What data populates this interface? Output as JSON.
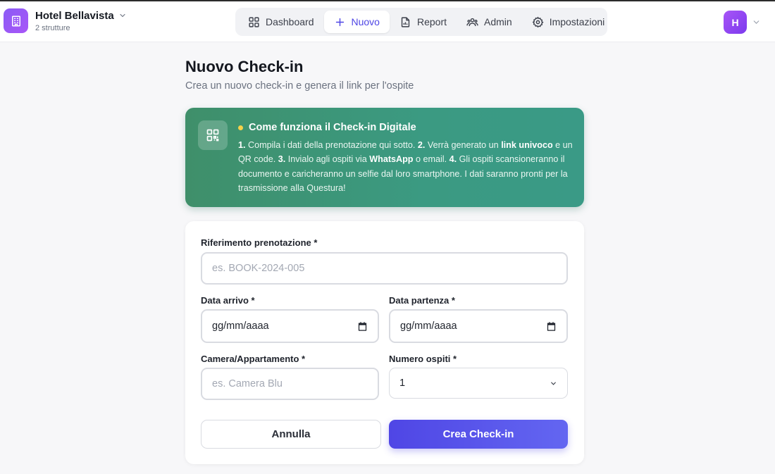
{
  "header": {
    "hotel_name": "Hotel Bellavista",
    "hotel_sub": "2 strutture",
    "avatar_initial": "H",
    "nav": [
      {
        "label": "Dashboard",
        "icon": "dashboard-icon"
      },
      {
        "label": "Nuovo",
        "icon": "plus-icon",
        "active": true
      },
      {
        "label": "Report",
        "icon": "report-icon"
      },
      {
        "label": "Admin",
        "icon": "users-icon"
      },
      {
        "label": "Impostazioni",
        "icon": "gear-icon"
      }
    ]
  },
  "page": {
    "title": "Nuovo Check-in",
    "subtitle": "Crea un nuovo check-in e genera il link per l'ospite"
  },
  "info": {
    "title": "Come funziona il Check-in Digitale",
    "parts": [
      {
        "t": "1.",
        "b": true
      },
      {
        "t": " Compila i dati della prenotazione qui sotto. ",
        "b": false
      },
      {
        "t": "2.",
        "b": true
      },
      {
        "t": " Verrà generato un ",
        "b": false
      },
      {
        "t": "link univoco",
        "b": true
      },
      {
        "t": " e un QR code. ",
        "b": false
      },
      {
        "t": "3.",
        "b": true
      },
      {
        "t": " Invialo agli ospiti via ",
        "b": false
      },
      {
        "t": "WhatsApp",
        "b": true
      },
      {
        "t": " o email. ",
        "b": false
      },
      {
        "t": "4.",
        "b": true
      },
      {
        "t": " Gli ospiti scansioneranno il documento e caricheranno un selfie dal loro smartphone. I dati saranno pronti per la trasmissione alla Questura!",
        "b": false
      }
    ]
  },
  "form": {
    "booking_label": "Riferimento prenotazione *",
    "booking_placeholder": "es. BOOK-2024-005",
    "arrival_label": "Data arrivo *",
    "arrival_value": "gg/mm/aaaa",
    "departure_label": "Data partenza *",
    "departure_value": "gg/mm/aaaa",
    "room_label": "Camera/Appartamento *",
    "room_placeholder": "es. Camera Blu",
    "guests_label": "Numero ospiti *",
    "guests_value": "1",
    "cancel_label": "Annulla",
    "submit_label": "Crea Check-in"
  },
  "colors": {
    "accent": "#4f46e5",
    "brand": "#8b5cf6",
    "info_bg": "#3b9a82"
  }
}
